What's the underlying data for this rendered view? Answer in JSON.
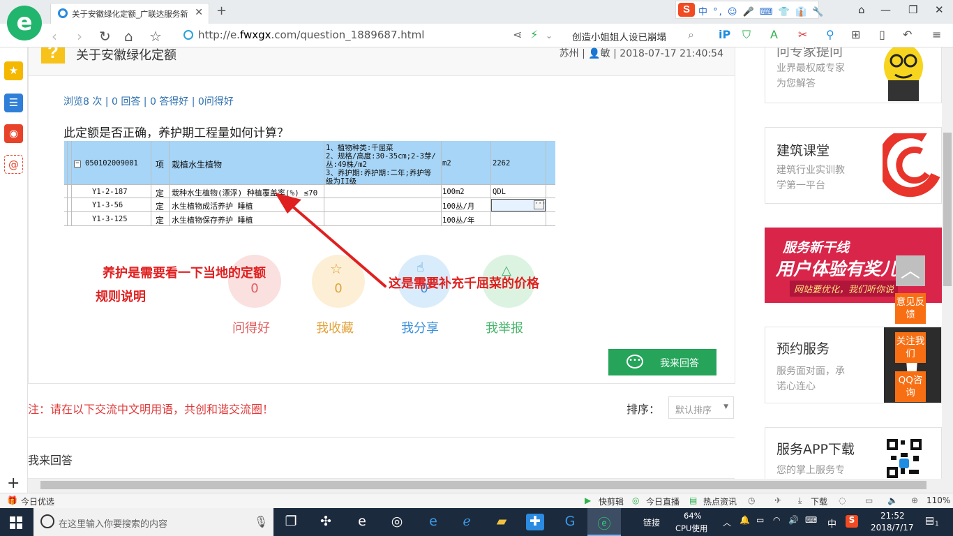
{
  "browser": {
    "tab_title": "关于安徽绿化定额_广联达服务新",
    "tab_close": "✕",
    "new_tab": "+",
    "url_prefix": "http://e.",
    "url_domain": "fwxgx",
    "url_suffix": ".com/question_1889687.html",
    "search_text": "创造小姐姐人设已崩塌",
    "ime_label": "中 °, ☺ 🎤 ⌨ 👕 👔 🔧"
  },
  "question": {
    "title": "关于安徽绿化定额",
    "meta": "苏州 | 👤敏 | 2018-07-17 21:40:54",
    "stats": "浏览8 次 | 0 回答 | 0 答得好 | 0问得好",
    "text": "此定额是否正确，养护期工程量如何计算？"
  },
  "table": {
    "header": {
      "code": "050102009001",
      "type": "项",
      "name": "栽植水生植物",
      "desc1": "1、植物种类:千屈菜",
      "desc2": "2、规格/高度:30-35cm;2-3芽/",
      "desc3": "丛:49株/m2",
      "desc4": "3、养护期:养护期:二年;养护等",
      "desc5": "级为II级",
      "unit": "m2",
      "qty": "2262"
    },
    "rows": [
      {
        "code": "Y1-2-187",
        "type": "定",
        "name": "栽种水生植物(漂浮) 种植覆盖率(%) ≤70",
        "unit": "100m2",
        "qty": "QDL"
      },
      {
        "code": "Y1-3-56",
        "type": "定",
        "name": "水生植物成活养护 睡植",
        "unit": "100丛/月",
        "qty": ""
      },
      {
        "code": "Y1-3-125",
        "type": "定",
        "name": "水生植物保存养护 睡植",
        "unit": "100丛/年",
        "qty": ""
      }
    ],
    "minus": "−",
    "dots": "···"
  },
  "annotations": {
    "left_line1": "养护是需要看一下当地的定额",
    "left_line2": "规则说明",
    "right": "这是需要补充千屈菜的价格"
  },
  "actions": [
    {
      "label": "问得好",
      "count": "0",
      "color": "#e25b5b"
    },
    {
      "label": "我收藏",
      "count": "0",
      "color": "#e2a23a"
    },
    {
      "label": "我分享",
      "count": "0",
      "color": "#3a8fdc"
    },
    {
      "label": "我举报",
      "count": "",
      "color": "#45b46a"
    }
  ],
  "answer_button": "我来回答",
  "notice": "注：请在以下交流中文明用语，共创和谐交流圈！",
  "sort": {
    "label": "排序：",
    "value": "默认排序",
    "arrow": "▼"
  },
  "my_answer": "我来回答",
  "side": {
    "expert_title": "问专家提问",
    "expert_sub1": "业界最权威专家",
    "expert_sub2": "为您解答",
    "course_title": "建筑课堂",
    "course_sub1": "建筑行业实训教",
    "course_sub2": "学第一平台",
    "banner_line1": "服务新干线",
    "banner_line2": "用户体验有奖儿研",
    "banner_line3": "网站要优化，我们听你说",
    "booking_title": "预约服务",
    "booking_sub1": "服务面对面，承",
    "booking_sub2": "诺心连心",
    "app_title": "服务APP下载",
    "app_sub1": "您的掌上服务专"
  },
  "float": {
    "top_arrow": "︿",
    "feedback": "意见反馈",
    "follow": "关注我们",
    "qq": "QQ咨询"
  },
  "statusbar": {
    "left": "今日优选",
    "item1": "快剪辑",
    "item2": "今日直播",
    "item3": "热点资讯",
    "item4": "下载",
    "zoom": "110%"
  },
  "taskbar": {
    "search_placeholder": "在这里输入你要搜索的内容",
    "link": "链接",
    "cpu_value": "64%",
    "cpu_label": "CPU使用",
    "lang": "中",
    "time": "21:52",
    "date": "2018/7/17",
    "notif": "1"
  }
}
